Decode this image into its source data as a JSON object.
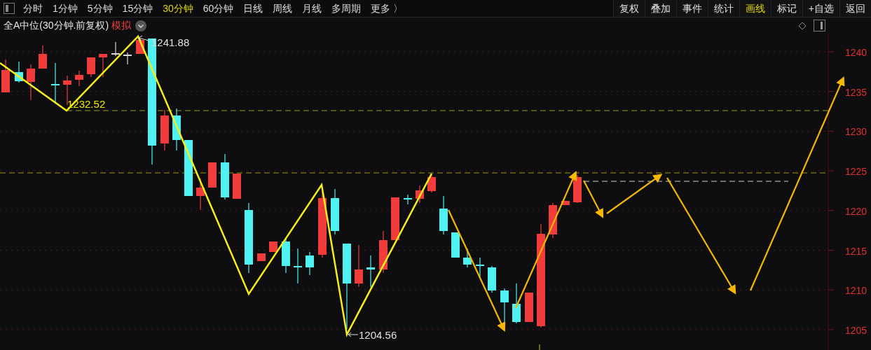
{
  "periods": [
    {
      "label": "分时",
      "selected": false
    },
    {
      "label": "1分钟",
      "selected": false
    },
    {
      "label": "5分钟",
      "selected": false
    },
    {
      "label": "15分钟",
      "selected": false
    },
    {
      "label": "30分钟",
      "selected": true
    },
    {
      "label": "60分钟",
      "selected": false
    },
    {
      "label": "日线",
      "selected": false
    },
    {
      "label": "周线",
      "selected": false
    },
    {
      "label": "月线",
      "selected": false
    },
    {
      "label": "多周期",
      "selected": false
    },
    {
      "label": "更多 〉",
      "selected": false
    }
  ],
  "tools": [
    {
      "label": "复权",
      "selected": false
    },
    {
      "label": "叠加",
      "selected": false
    },
    {
      "label": "事件",
      "selected": false
    },
    {
      "label": "统计",
      "selected": false
    },
    {
      "label": "画线",
      "selected": true
    },
    {
      "label": "标记",
      "selected": false
    },
    {
      "label": "+自选",
      "selected": false
    },
    {
      "label": "返回",
      "selected": false
    }
  ],
  "chart_title": "全A中位(30分钟.前复权)",
  "mode_tag": "模拟",
  "price_axis": [
    "1240",
    "1235",
    "1230",
    "1225",
    "1220",
    "1215",
    "1210",
    "1205"
  ],
  "annotations": [
    "1241.88",
    "1232.52",
    "1204.56"
  ]
}
